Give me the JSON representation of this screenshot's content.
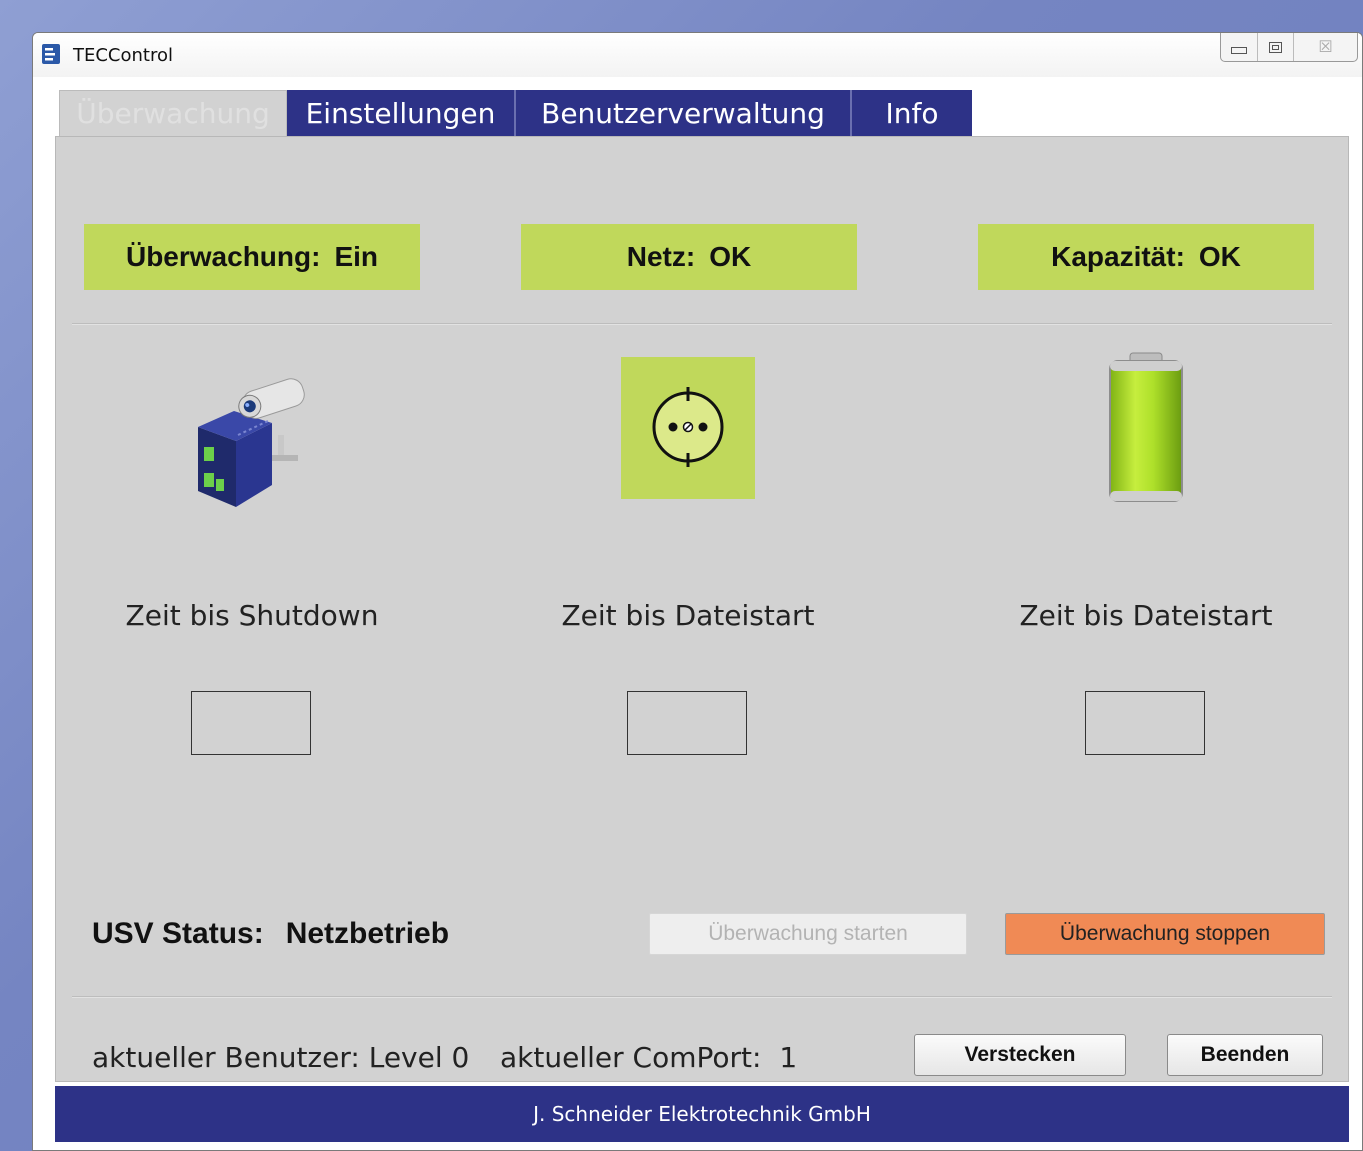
{
  "window": {
    "title": "TECControl",
    "close_glyph": "☒"
  },
  "tabs": [
    {
      "label": "Überwachung",
      "active": true
    },
    {
      "label": "Einstellungen",
      "active": false
    },
    {
      "label": "Benutzerverwaltung",
      "active": false
    },
    {
      "label": "Info",
      "active": false
    }
  ],
  "status": {
    "monitoring": {
      "label": "Überwachung:",
      "value": "Ein"
    },
    "grid": {
      "label": "Netz:",
      "value": "OK"
    },
    "capacity": {
      "label": "Kapazität:",
      "value": "OK"
    }
  },
  "pictures": {
    "monitoring": "camera-device-icon",
    "grid": "power-socket-icon",
    "capacity": "battery-icon"
  },
  "timers": [
    {
      "label": "Zeit bis Shutdown",
      "value": ""
    },
    {
      "label": "Zeit bis Dateistart",
      "value": ""
    },
    {
      "label": "Zeit bis Dateistart",
      "value": ""
    }
  ],
  "usv": {
    "label": "USV Status:",
    "value": "Netzbetrieb"
  },
  "buttons": {
    "start": "Überwachung starten",
    "stop": "Überwachung stoppen",
    "hide": "Verstecken",
    "quit": "Beenden"
  },
  "footer": {
    "user_label": "aktueller Benutzer:",
    "user_value": "Level 0",
    "comport_label": "aktueller ComPort:",
    "comport_value": "1"
  },
  "company": "J. Schneider Elektrotechnik GmbH",
  "colors": {
    "status_ok": "#c0d85b",
    "tab_blue": "#2d3287",
    "stop_button": "#f08a55"
  }
}
